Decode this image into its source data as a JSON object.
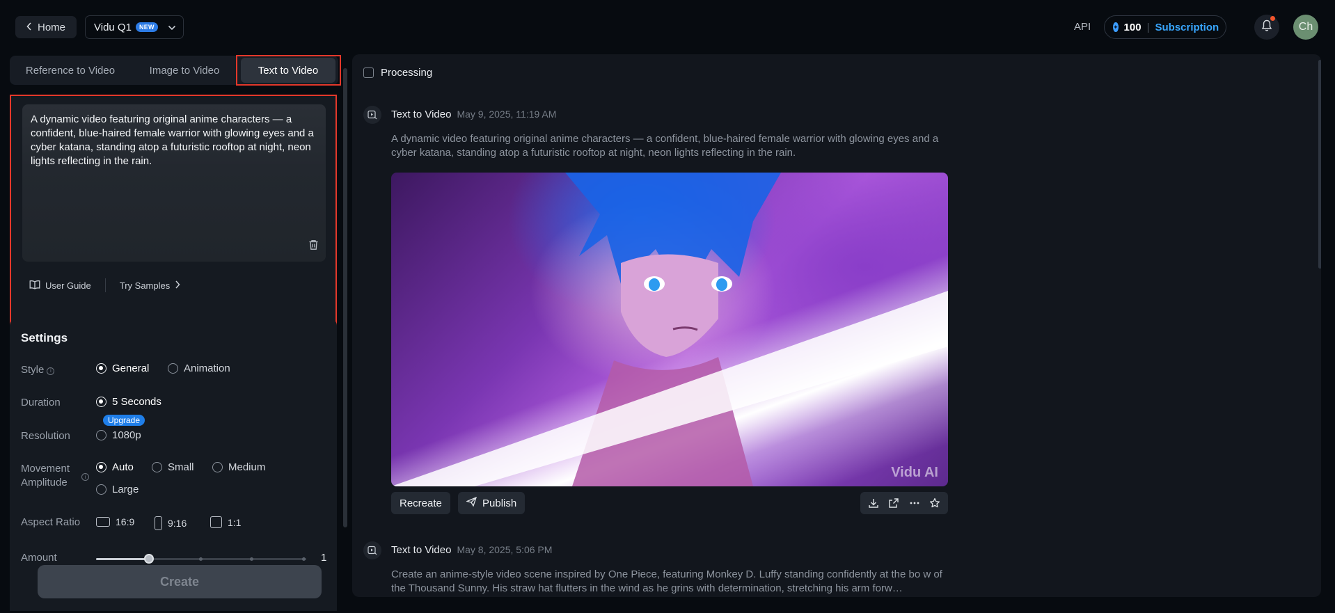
{
  "topbar": {
    "home_label": "Home",
    "model_name": "Vidu Q1",
    "model_badge": "NEW",
    "api_label": "API",
    "credits": "100",
    "subscription_label": "Subscription",
    "avatar_initials": "Ch"
  },
  "tabs": [
    {
      "label": "Reference to Video"
    },
    {
      "label": "Image to Video"
    },
    {
      "label": "Text to Video",
      "active": true
    }
  ],
  "prompt": {
    "text": "A dynamic video featuring original anime characters — a confident, blue-haired female warrior with glowing eyes and a cyber katana, standing atop a futuristic rooftop at night, neon lights reflecting in the rain.",
    "user_guide_label": "User Guide",
    "try_samples_label": "Try Samples"
  },
  "settings": {
    "title": "Settings",
    "style": {
      "label": "Style",
      "options": [
        "General",
        "Animation"
      ],
      "selected": "General"
    },
    "duration": {
      "label": "Duration",
      "options": [
        "5 Seconds"
      ],
      "selected": "5 Seconds"
    },
    "resolution": {
      "label": "Resolution",
      "options": [
        "1080p"
      ],
      "badge": "Upgrade"
    },
    "movement": {
      "label": "Movement Amplitude",
      "options": [
        "Auto",
        "Small",
        "Medium",
        "Large"
      ],
      "selected": "Auto"
    },
    "aspect": {
      "label": "Aspect Ratio",
      "options": [
        "16:9",
        "9:16",
        "1:1"
      ]
    },
    "amount": {
      "label": "Amount",
      "value": "1",
      "fraction": 0.25
    },
    "create_label": "Create"
  },
  "feed": {
    "processing_label": "Processing",
    "items": [
      {
        "type": "Text to Video",
        "date": "May 9, 2025, 11:19 AM",
        "prompt": "A dynamic video featuring original anime characters — a confident, blue-haired female warrior with glowing eyes and a cyber katana, standing atop a futuristic rooftop at night, neon lights reflecting in the rain.",
        "watermark": "Vidu AI",
        "recreate_label": "Recreate",
        "publish_label": "Publish"
      },
      {
        "type": "Text to Video",
        "date": "May 8, 2025, 5:06 PM",
        "prompt": "Create an anime-style video scene inspired by One Piece, featuring Monkey D. Luffy standing confidently at the bo w of the Thousand Sunny. His straw hat flutters in the wind as he grins with determination, stretching his arm forw…"
      }
    ]
  },
  "icons": {
    "back": "chevron-left-icon",
    "dropdown": "chevron-down-icon",
    "credit": "credit-icon",
    "notification": "bell-icon",
    "delete": "trash-icon",
    "guide": "book-icon",
    "samples": "chevron-right-icon",
    "generation": "video-generate-icon",
    "publish": "send-icon",
    "download": "download-icon",
    "share": "share-icon",
    "more": "more-icon",
    "favorite": "star-icon"
  },
  "colors": {
    "accent": "#38a6ff",
    "highlight": "#e4382a",
    "badge": "#2c7be5"
  }
}
